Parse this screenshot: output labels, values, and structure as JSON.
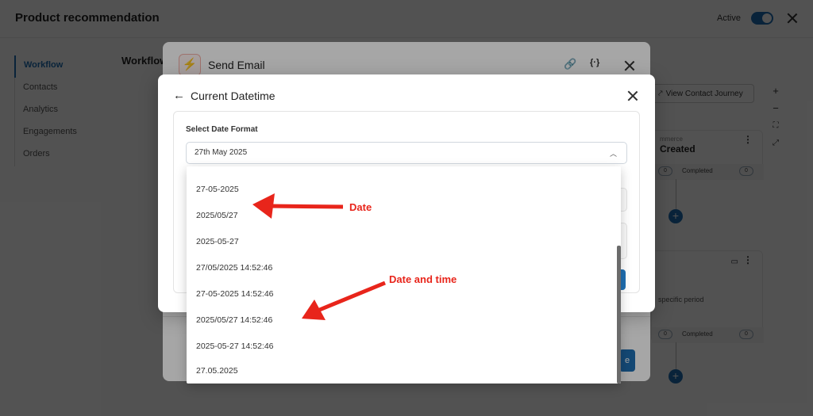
{
  "header": {
    "title": "Product recommendation",
    "active_label": "Active"
  },
  "sidebar": {
    "items": [
      {
        "label": "Workflow"
      },
      {
        "label": "Contacts"
      },
      {
        "label": "Analytics"
      },
      {
        "label": "Engagements"
      },
      {
        "label": "Orders"
      }
    ]
  },
  "workflow": {
    "heading": "Workflow",
    "view_journey_label": "View Contact Journey",
    "zoom_in": "+",
    "zoom_out": "−",
    "node1": {
      "subtitle": "mmerce",
      "title": "Created",
      "count_left": "0",
      "completed_label": "Completed",
      "count_right": "0"
    },
    "node2": {
      "text": "specific period",
      "count_left": "0",
      "completed_label": "Completed",
      "count_right": "0"
    },
    "add_icon": "+"
  },
  "email_panel": {
    "title": "Send Email",
    "icon_name": "lightning-icon",
    "save_fragment": "e"
  },
  "modal": {
    "title": "Current Datetime",
    "field_label": "Select Date Format",
    "selected_value": "27th May 2025",
    "options": [
      "27-05-2025",
      "2025/05/27",
      "2025-05-27",
      "27/05/2025 14:52:46",
      "27-05-2025 14:52:46",
      "2025/05/27 14:52:46",
      "2025-05-27 14:52:46",
      "27.05.2025"
    ]
  },
  "annotations": {
    "date_label": "Date",
    "datetime_label": "Date and time",
    "color": "#e8251b"
  },
  "colors": {
    "accent": "#1f6fb2",
    "email_icon": "#e0503a"
  }
}
